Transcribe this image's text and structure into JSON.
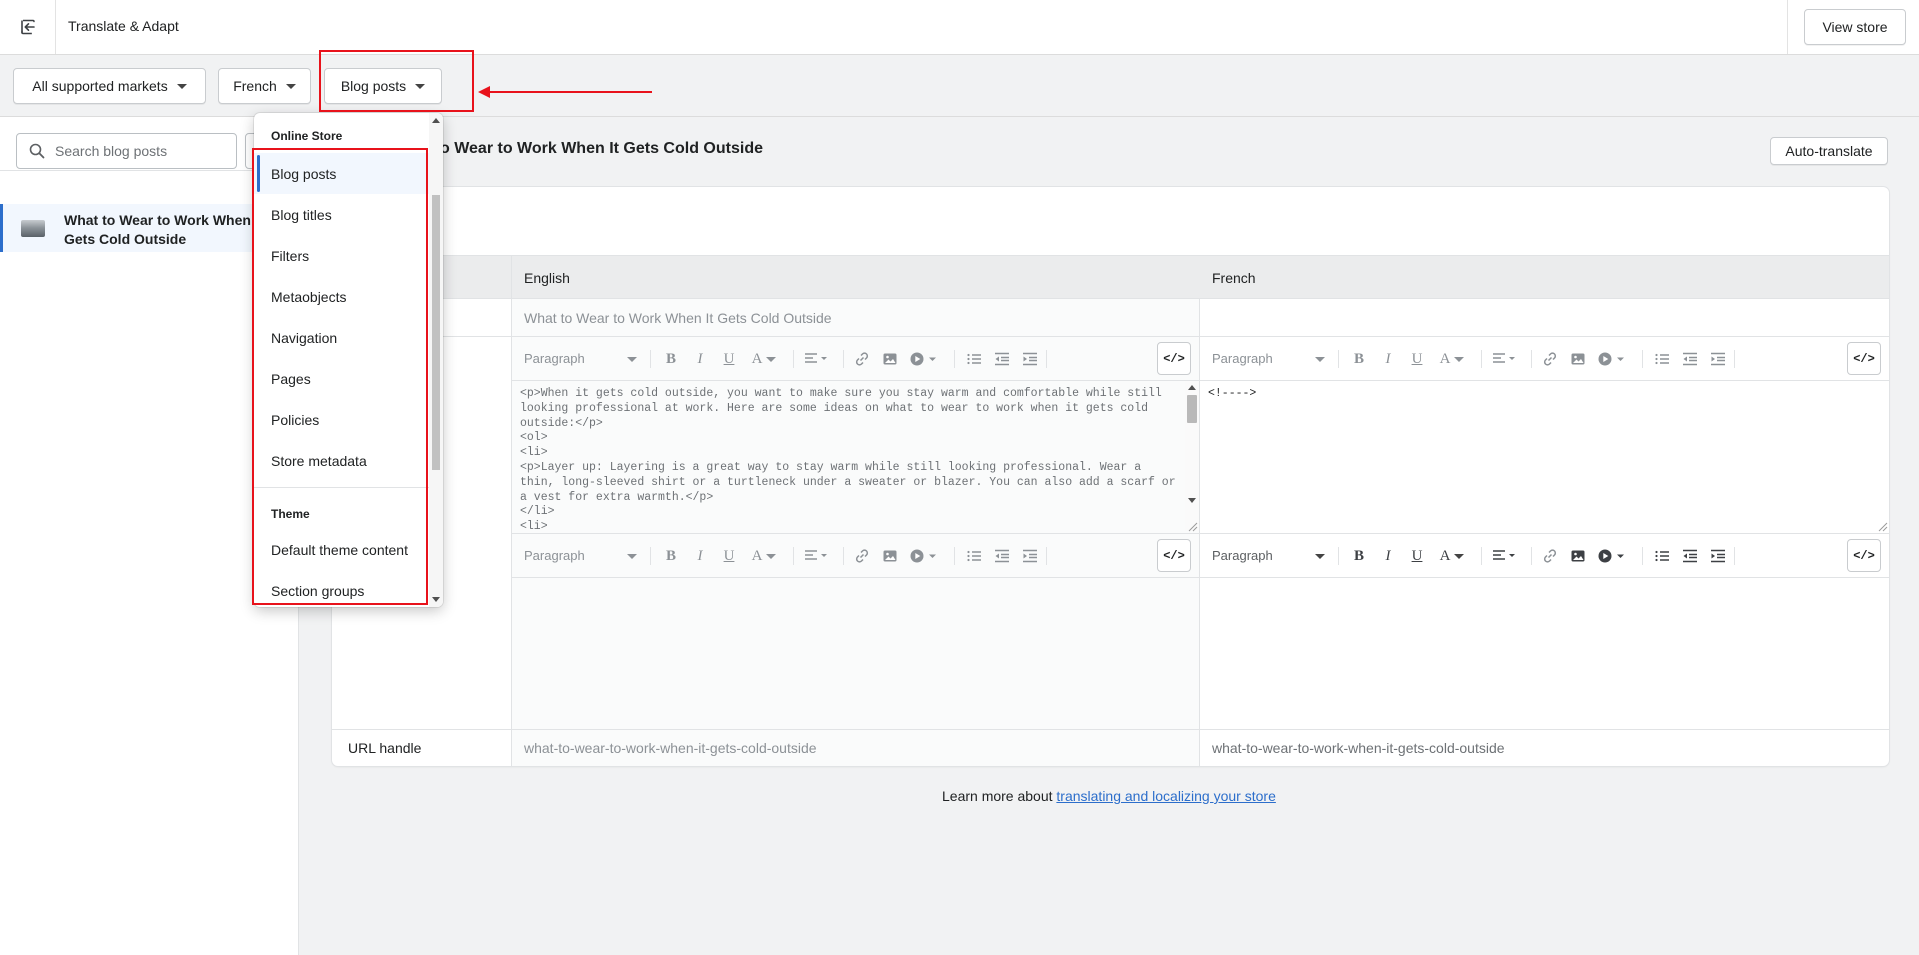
{
  "header": {
    "back_icon": "exit-icon",
    "app_title": "Translate & Adapt",
    "view_store_label": "View store"
  },
  "filters": {
    "market_label": "All supported markets",
    "language_label": "French",
    "resource_label": "Blog posts"
  },
  "sidebar": {
    "search_placeholder": "Search blog posts",
    "items": [
      {
        "label": "What to Wear to Work When It Gets Cold Outside"
      }
    ]
  },
  "main": {
    "title": "What to Wear to Work When It Gets Cold Outside",
    "visible_title_fragment": "o Wear to Work When It Gets Cold Outside",
    "auto_translate_label": "Auto-translate",
    "columns": {
      "source": "English",
      "target": "French"
    },
    "rows": {
      "title": {
        "source": "What to Wear to Work When It Gets Cold Outside",
        "target": ""
      },
      "url_handle": {
        "label": "URL handle",
        "source": "what-to-wear-to-work-when-it-gets-cold-outside",
        "target": "what-to-wear-to-work-when-it-gets-cold-outside"
      }
    },
    "editor": {
      "paragraph_label": "Paragraph",
      "code_toggle": "</>",
      "source_html": "<p>When it gets cold outside, you want to make sure you stay warm and comfortable while still looking professional at work. Here are some ideas on what to wear to work when it gets cold outside:</p>\n<ol>\n<li>\n<p>Layer up: Layering is a great way to stay warm while still looking professional. Wear a thin, long-sleeved shirt or a turtleneck under a sweater or blazer. You can also add a scarf or a vest for extra warmth.</p>\n</li>\n<li>",
      "target_html": "<!---->"
    },
    "learn_more_prefix": "Learn more about ",
    "learn_more_link": "translating and localizing your store"
  },
  "dropdown": {
    "sections": [
      {
        "heading": "Online Store",
        "items": [
          "Blog posts",
          "Blog titles",
          "Filters",
          "Metaobjects",
          "Navigation",
          "Pages",
          "Policies",
          "Store metadata"
        ]
      },
      {
        "heading": "Theme",
        "items": [
          "Default theme content",
          "Section groups"
        ]
      }
    ],
    "selected": "Blog posts"
  },
  "colors": {
    "accent": "#2c6ecb",
    "annotation": "#e8121b",
    "selected_bg": "#f2f7fe"
  }
}
